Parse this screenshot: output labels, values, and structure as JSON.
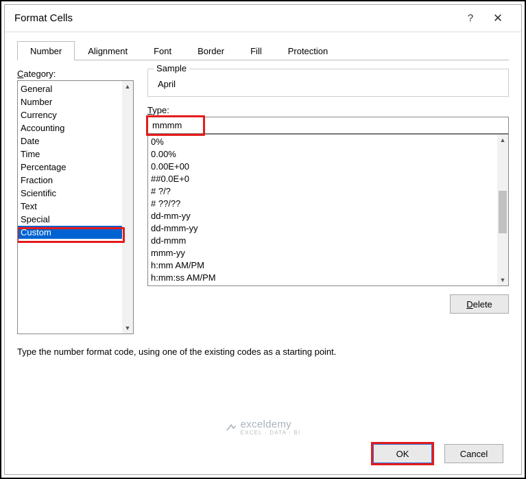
{
  "dialog": {
    "title": "Format Cells"
  },
  "tabs": {
    "number": "Number",
    "alignment": "Alignment",
    "font": "Font",
    "border": "Border",
    "fill": "Fill",
    "protection": "Protection"
  },
  "labels": {
    "category": "Category:",
    "sample": "Sample",
    "type": "Type:"
  },
  "categories": [
    "General",
    "Number",
    "Currency",
    "Accounting",
    "Date",
    "Time",
    "Percentage",
    "Fraction",
    "Scientific",
    "Text",
    "Special",
    "Custom"
  ],
  "selected_category_index": 11,
  "sample_value": "April",
  "type_value": "mmmm",
  "formats": [
    "0%",
    "0.00%",
    "0.00E+00",
    "##0.0E+0",
    "# ?/?",
    "# ??/??",
    "dd-mm-yy",
    "dd-mmm-yy",
    "dd-mmm",
    "mmm-yy",
    "h:mm AM/PM",
    "h:mm:ss AM/PM"
  ],
  "buttons": {
    "delete": "Delete",
    "ok": "OK",
    "cancel": "Cancel"
  },
  "hint": "Type the number format code, using one of the existing codes as a starting point.",
  "watermark": {
    "brand": "exceldemy",
    "tagline": "EXCEL · DATA · BI"
  }
}
